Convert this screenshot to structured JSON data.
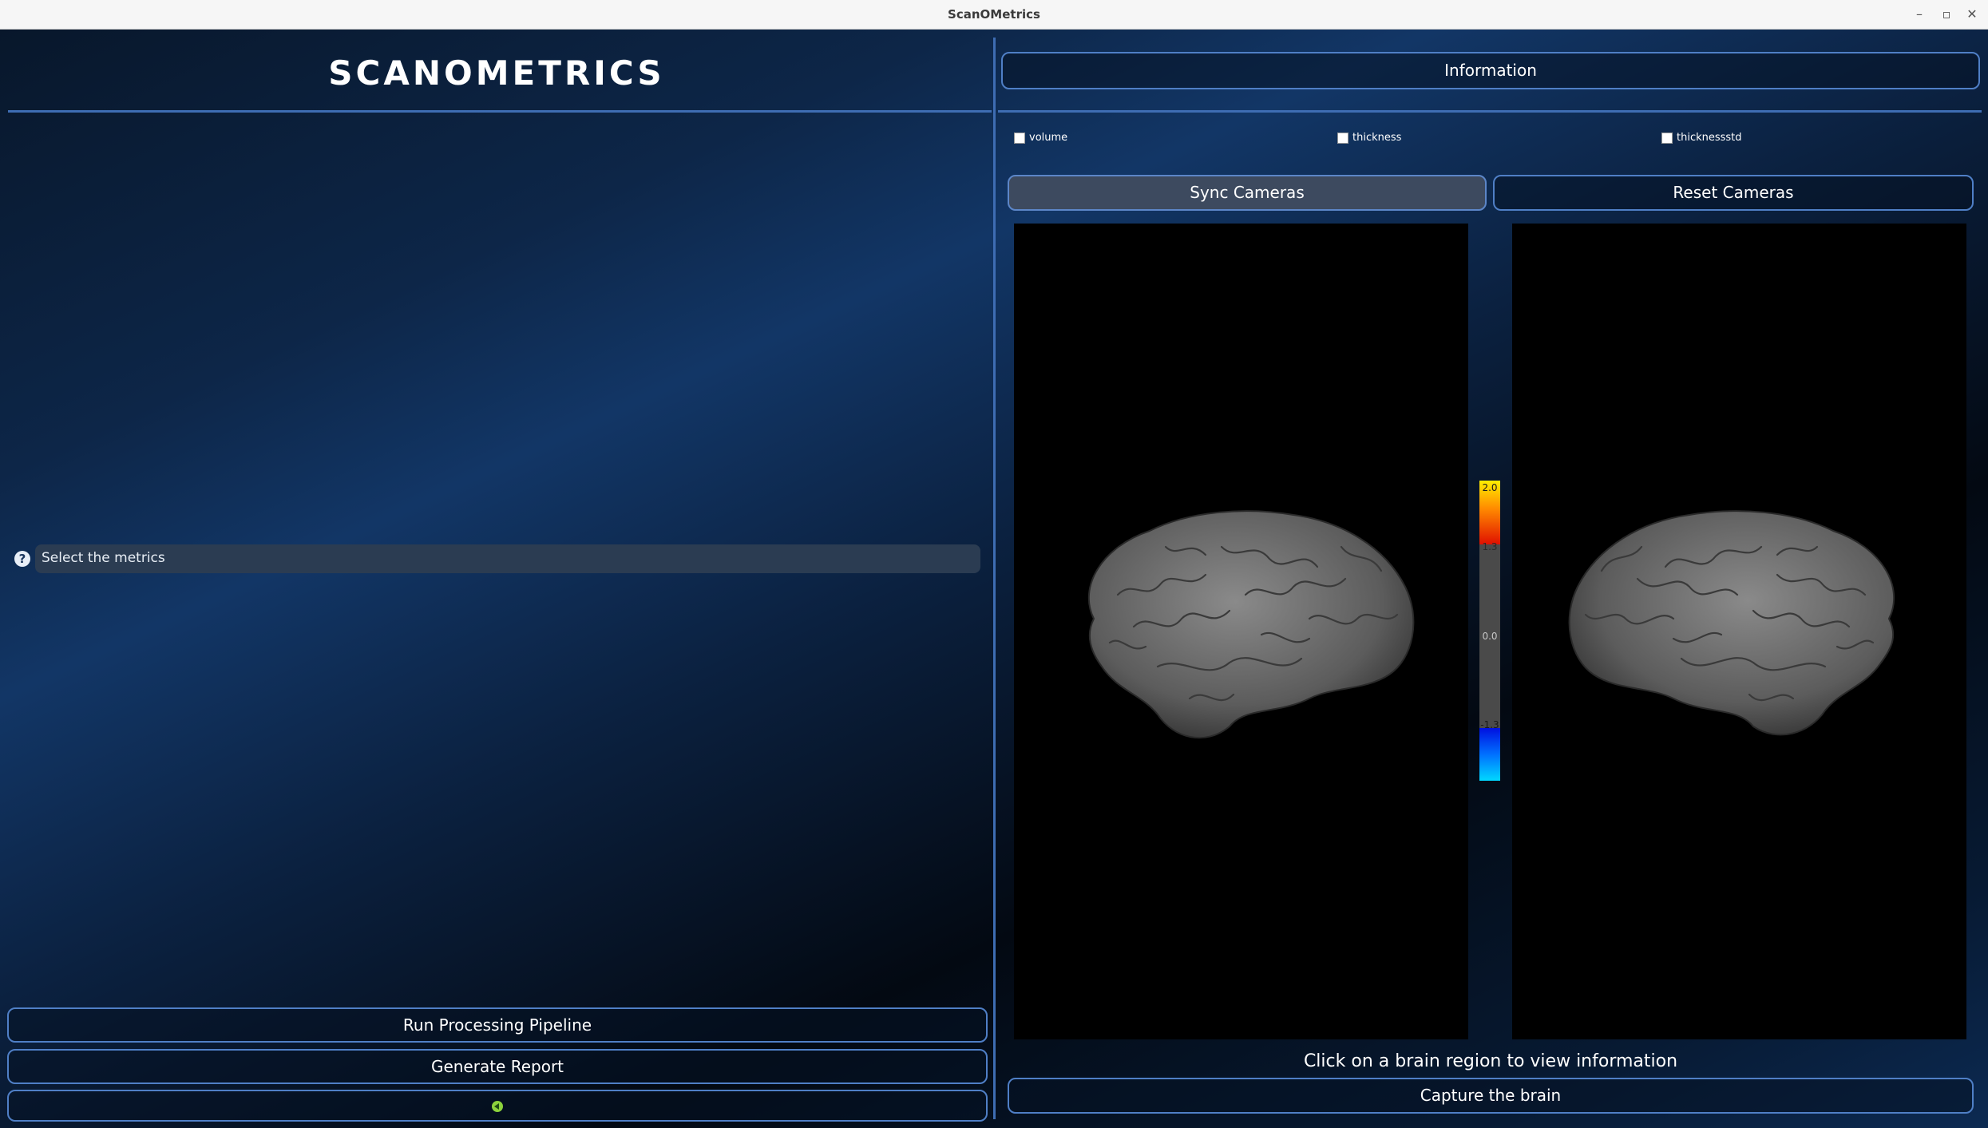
{
  "window": {
    "title": "ScanOMetrics",
    "minimize_glyph": "–",
    "restore_glyph": "▫",
    "close_glyph": "✕"
  },
  "left_panel": {
    "app_title": "SCANOMETRICS",
    "metric_selector": {
      "placeholder": "Select the metrics",
      "help_glyph": "?"
    },
    "buttons": {
      "run_pipeline": "Run Processing Pipeline",
      "generate_report": "Generate Report"
    }
  },
  "right_panel": {
    "information_button": "Information",
    "metric_checkboxes": [
      {
        "label": "volume",
        "checked": false
      },
      {
        "label": "thickness",
        "checked": false
      },
      {
        "label": "thicknessstd",
        "checked": false
      }
    ],
    "sync_cameras": "Sync Cameras",
    "reset_cameras": "Reset Cameras",
    "colorbar": {
      "ticks": [
        "2.0",
        "1.3",
        "0.0",
        "-1.3"
      ]
    },
    "region_message": "Click on a brain region to view information",
    "capture_button": "Capture the brain"
  },
  "colors": {
    "accent": "#3e6db3",
    "button_border": "#4f7fc6",
    "selected_button": "#3d4a5f"
  },
  "icons": [
    "help-icon",
    "back-arrow-icon"
  ]
}
